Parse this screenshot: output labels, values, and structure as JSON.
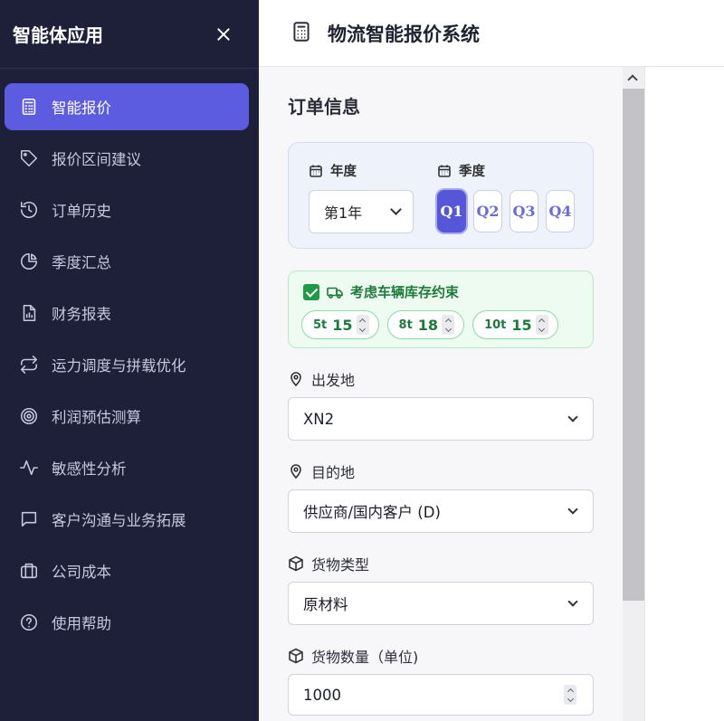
{
  "sidebar": {
    "title": "智能体应用",
    "items": [
      {
        "label": "智能报价",
        "icon": "calculator-icon",
        "active": true
      },
      {
        "label": "报价区间建议",
        "icon": "tag-icon",
        "active": false
      },
      {
        "label": "订单历史",
        "icon": "history-icon",
        "active": false
      },
      {
        "label": "季度汇总",
        "icon": "pie-chart-icon",
        "active": false
      },
      {
        "label": "财务报表",
        "icon": "report-icon",
        "active": false
      },
      {
        "label": "运力调度与拼载优化",
        "icon": "swap-arrows-icon",
        "active": false
      },
      {
        "label": "利润预估测算",
        "icon": "target-icon",
        "active": false
      },
      {
        "label": "敏感性分析",
        "icon": "pulse-icon",
        "active": false
      },
      {
        "label": "客户沟通与业务拓展",
        "icon": "chat-icon",
        "active": false
      },
      {
        "label": "公司成本",
        "icon": "briefcase-icon",
        "active": false
      },
      {
        "label": "使用帮助",
        "icon": "help-icon",
        "active": false
      }
    ]
  },
  "header": {
    "title": "物流智能报价系统",
    "icon": "calculator-icon"
  },
  "form": {
    "section_title": "订单信息",
    "year": {
      "label": "年度",
      "value": "第1年"
    },
    "quarter": {
      "label": "季度",
      "options": [
        "Q1",
        "Q2",
        "Q3",
        "Q4"
      ],
      "selected": "Q1"
    },
    "vehicle_stock": {
      "label": "考虑车辆库存约束",
      "checked": true,
      "items": [
        {
          "type": "5t",
          "value": "15"
        },
        {
          "type": "8t",
          "value": "18"
        },
        {
          "type": "10t",
          "value": "15"
        }
      ]
    },
    "origin": {
      "label": "出发地",
      "value": "XN2"
    },
    "destination": {
      "label": "目的地",
      "value": "供应商/国内客户 (D)"
    },
    "cargo_type": {
      "label": "货物类型",
      "value": "原材料"
    },
    "quantity": {
      "label": "货物数量（单位)",
      "value": "1000"
    }
  },
  "colors": {
    "sidebar_bg": "#1e1f38",
    "accent": "#5c5ce0",
    "success": "#1f9a47"
  }
}
